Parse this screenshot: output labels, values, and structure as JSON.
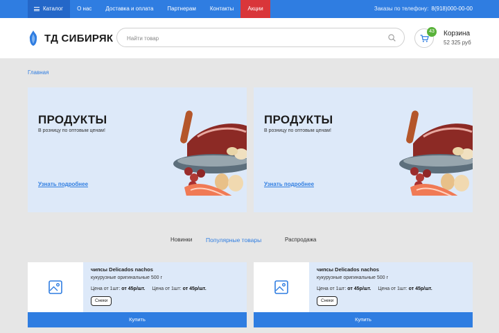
{
  "nav": {
    "items": [
      {
        "label": "Каталог"
      },
      {
        "label": "О нас"
      },
      {
        "label": "Доставка и оплата"
      },
      {
        "label": "Партнерам"
      },
      {
        "label": "Контакты"
      },
      {
        "label": "Акции"
      }
    ],
    "phone_label": "Заказы по телефону:",
    "phone_number": "8(918)000-00-00"
  },
  "header": {
    "logo_text": "ТД СИБИРЯК",
    "search_placeholder": "Найти товар",
    "cart": {
      "count": "43",
      "title": "Корзина",
      "sum": "52 325 руб"
    }
  },
  "breadcrumb": "Главная",
  "banners": [
    {
      "title": "ПРОДУКТЫ",
      "subtitle": "В розницу по оптовым ценам!",
      "link": "Узнать подробнее"
    },
    {
      "title": "ПРОДУКТЫ",
      "subtitle": "В розницу по оптовым ценам!",
      "link": "Узнать подробнее"
    }
  ],
  "tabs": [
    {
      "label": "Новинки"
    },
    {
      "label": "Популярные товары"
    },
    {
      "label": "Распродажа"
    }
  ],
  "products": [
    {
      "name": "чипсы Delicados nachos",
      "desc": "кукурузные оригинальные 500 г",
      "price1_label": "Цена от 1шт:",
      "price1": "от 45р/шт.",
      "price2_label": "Цена от 1шт:",
      "price2": "от 45р/шт.",
      "tag": "Снеки",
      "buy": "Купить"
    },
    {
      "name": "чипсы Delicados nachos",
      "desc": "кукурузные оригинальные 500 г",
      "price1_label": "Цена от 1шт:",
      "price1": "от 45р/шт.",
      "price2_label": "Цена от 1шт:",
      "price2": "от 45р/шт.",
      "tag": "Снеки",
      "buy": "Купить"
    }
  ],
  "colors": {
    "primary": "#2f7de1",
    "promo": "#d9363a",
    "badge": "#59b23a",
    "panel": "#dde9f9"
  }
}
